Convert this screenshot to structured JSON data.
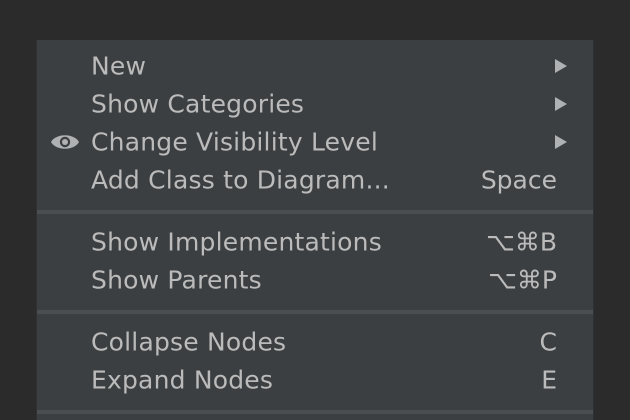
{
  "menu": {
    "items": [
      {
        "label": "New",
        "submenu": true
      },
      {
        "label": "Show Categories",
        "submenu": true
      },
      {
        "label": "Change Visibility Level",
        "submenu": true,
        "icon": "eye-icon"
      },
      {
        "label": "Add Class to Diagram...",
        "shortcut": "Space"
      },
      {
        "label": "Show Implementations",
        "shortcut": "⌥⌘B"
      },
      {
        "label": "Show Parents",
        "shortcut": "⌥⌘P"
      },
      {
        "label": "Collapse Nodes",
        "shortcut": "C"
      },
      {
        "label": "Expand Nodes",
        "shortcut": "E"
      }
    ]
  },
  "colors": {
    "background": "#2b2b2b",
    "menu_background": "#3c3f41",
    "text": "#bbbbbb",
    "separator": "#4b4e50"
  }
}
